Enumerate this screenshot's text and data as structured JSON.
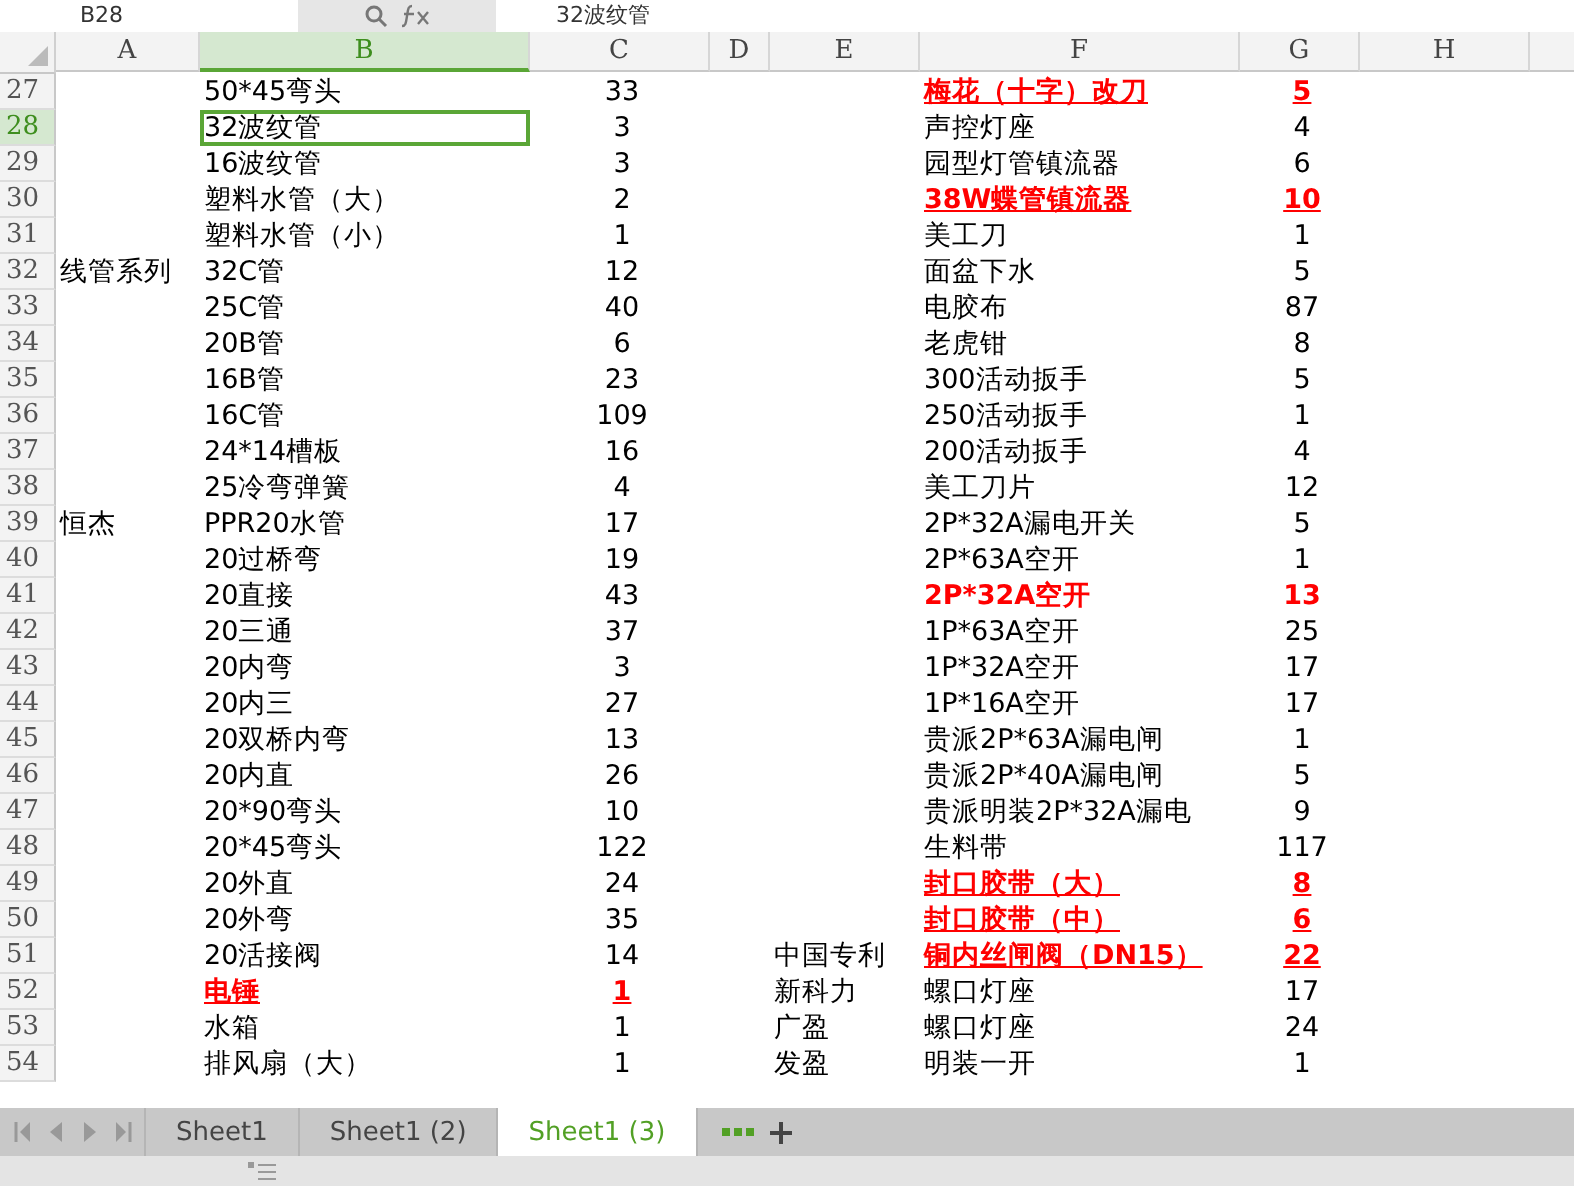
{
  "formula_bar": {
    "cell_ref": "B28",
    "formula": "32波纹管"
  },
  "columns": [
    {
      "label": "A",
      "selected": false
    },
    {
      "label": "B",
      "selected": true
    },
    {
      "label": "C",
      "selected": false
    },
    {
      "label": "D",
      "selected": false
    },
    {
      "label": "E",
      "selected": false
    },
    {
      "label": "F",
      "selected": false
    },
    {
      "label": "G",
      "selected": false
    },
    {
      "label": "H",
      "selected": false
    }
  ],
  "rows": [
    {
      "number": "27",
      "selected": false,
      "b": "50*45弯头",
      "c": "33",
      "f": "梅花（十字）改刀",
      "g": "5",
      "right_red": true,
      "right_underlined": true
    },
    {
      "number": "28",
      "selected": true,
      "b": "32波纹管",
      "c": "3",
      "f": "声控灯座",
      "g": "4"
    },
    {
      "number": "29",
      "selected": false,
      "b": "16波纹管",
      "c": "3",
      "f": "园型灯管镇流器",
      "g": "6"
    },
    {
      "number": "30",
      "selected": false,
      "b": "塑料水管（大）",
      "c": "2",
      "f": "38W蝶管镇流器",
      "g": "10",
      "right_red": true,
      "right_underlined": true
    },
    {
      "number": "31",
      "selected": false,
      "b": "塑料水管（小）",
      "c": "1",
      "f": "美工刀",
      "g": "1"
    },
    {
      "number": "32",
      "selected": false,
      "a": "线管系列",
      "b": "32C管",
      "c": "12",
      "f": "面盆下水",
      "g": "5"
    },
    {
      "number": "33",
      "selected": false,
      "b": "25C管",
      "c": "40",
      "f": "电胶布",
      "g": "87"
    },
    {
      "number": "34",
      "selected": false,
      "b": "20B管",
      "c": "6",
      "f": "老虎钳",
      "g": "8"
    },
    {
      "number": "35",
      "selected": false,
      "b": "16B管",
      "c": "23",
      "f": "300活动扳手",
      "g": "5"
    },
    {
      "number": "36",
      "selected": false,
      "b": "16C管",
      "c": "109",
      "f": "250活动扳手",
      "g": "1"
    },
    {
      "number": "37",
      "selected": false,
      "b": "24*14槽板",
      "c": "16",
      "f": "200活动扳手",
      "g": "4"
    },
    {
      "number": "38",
      "selected": false,
      "b": "25冷弯弹簧",
      "c": "4",
      "f": "美工刀片",
      "g": "12"
    },
    {
      "number": "39",
      "selected": false,
      "a": "恒杰",
      "b": "PPR20水管",
      "c": "17",
      "f": "2P*32A漏电开关",
      "g": "5"
    },
    {
      "number": "40",
      "selected": false,
      "b": "20过桥弯",
      "c": "19",
      "f": "2P*63A空开",
      "g": "1"
    },
    {
      "number": "41",
      "selected": false,
      "b": "20直接",
      "c": "43",
      "f": "2P*32A空开",
      "g": "13",
      "right_red": true,
      "right_underlined": false
    },
    {
      "number": "42",
      "selected": false,
      "b": "20三通",
      "c": "37",
      "f": "1P*63A空开",
      "g": "25"
    },
    {
      "number": "43",
      "selected": false,
      "b": "20内弯",
      "c": "3",
      "f": "1P*32A空开",
      "g": "17"
    },
    {
      "number": "44",
      "selected": false,
      "b": "20内三",
      "c": "27",
      "f": "1P*16A空开",
      "g": "17"
    },
    {
      "number": "45",
      "selected": false,
      "b": "20双桥内弯",
      "c": "13",
      "f": "贵派2P*63A漏电闸",
      "g": "1"
    },
    {
      "number": "46",
      "selected": false,
      "b": "20内直",
      "c": "26",
      "f": "贵派2P*40A漏电闸",
      "g": "5"
    },
    {
      "number": "47",
      "selected": false,
      "b": "20*90弯头",
      "c": "10",
      "f": "贵派明装2P*32A漏电",
      "g": "9"
    },
    {
      "number": "48",
      "selected": false,
      "b": "20*45弯头",
      "c": "122",
      "f": "生料带",
      "g": "117"
    },
    {
      "number": "49",
      "selected": false,
      "b": "20外直",
      "c": "24",
      "f": "封口胶带（大）",
      "g": "8",
      "right_red": true,
      "right_underlined": true
    },
    {
      "number": "50",
      "selected": false,
      "b": "20外弯",
      "c": "35",
      "f": "封口胶带（中）",
      "g": "6",
      "right_red": true,
      "right_underlined": true
    },
    {
      "number": "51",
      "selected": false,
      "b": "20活接阀",
      "c": "14",
      "e": "中国专利",
      "f": "铜内丝闸阀（DN15）",
      "g": "22",
      "right_red": true,
      "right_underlined": true
    },
    {
      "number": "52",
      "selected": false,
      "b": "电锤",
      "c": "1",
      "e": "新科力",
      "f": "螺口灯座",
      "g": "17",
      "left_red": true,
      "left_underlined": true
    },
    {
      "number": "53",
      "selected": false,
      "b": "水箱",
      "c": "1",
      "e": "广盈",
      "f": "螺口灯座",
      "g": "24"
    },
    {
      "number": "54",
      "selected": false,
      "b": "排风扇（大）",
      "c": "1",
      "e": "发盈",
      "f": "明装一开",
      "g": "1"
    }
  ],
  "sheet_tabs": [
    {
      "label": "Sheet1",
      "selected": false
    },
    {
      "label": "Sheet1 (2)",
      "selected": false
    },
    {
      "label": "Sheet1 (3)",
      "selected": true
    }
  ]
}
